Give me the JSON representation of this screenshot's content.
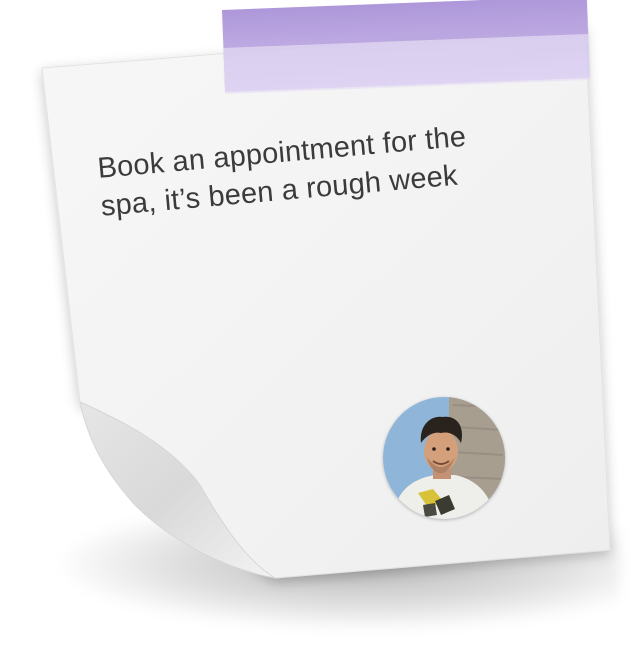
{
  "note": {
    "line1": "Book an appointment for the",
    "line2": "spa, it’s been a rough week"
  },
  "avatar": {
    "icon": "user-avatar-photo"
  },
  "colors": {
    "tape": "#b39ddb",
    "paper": "#f4f4f4",
    "text": "#3b3b3b"
  }
}
